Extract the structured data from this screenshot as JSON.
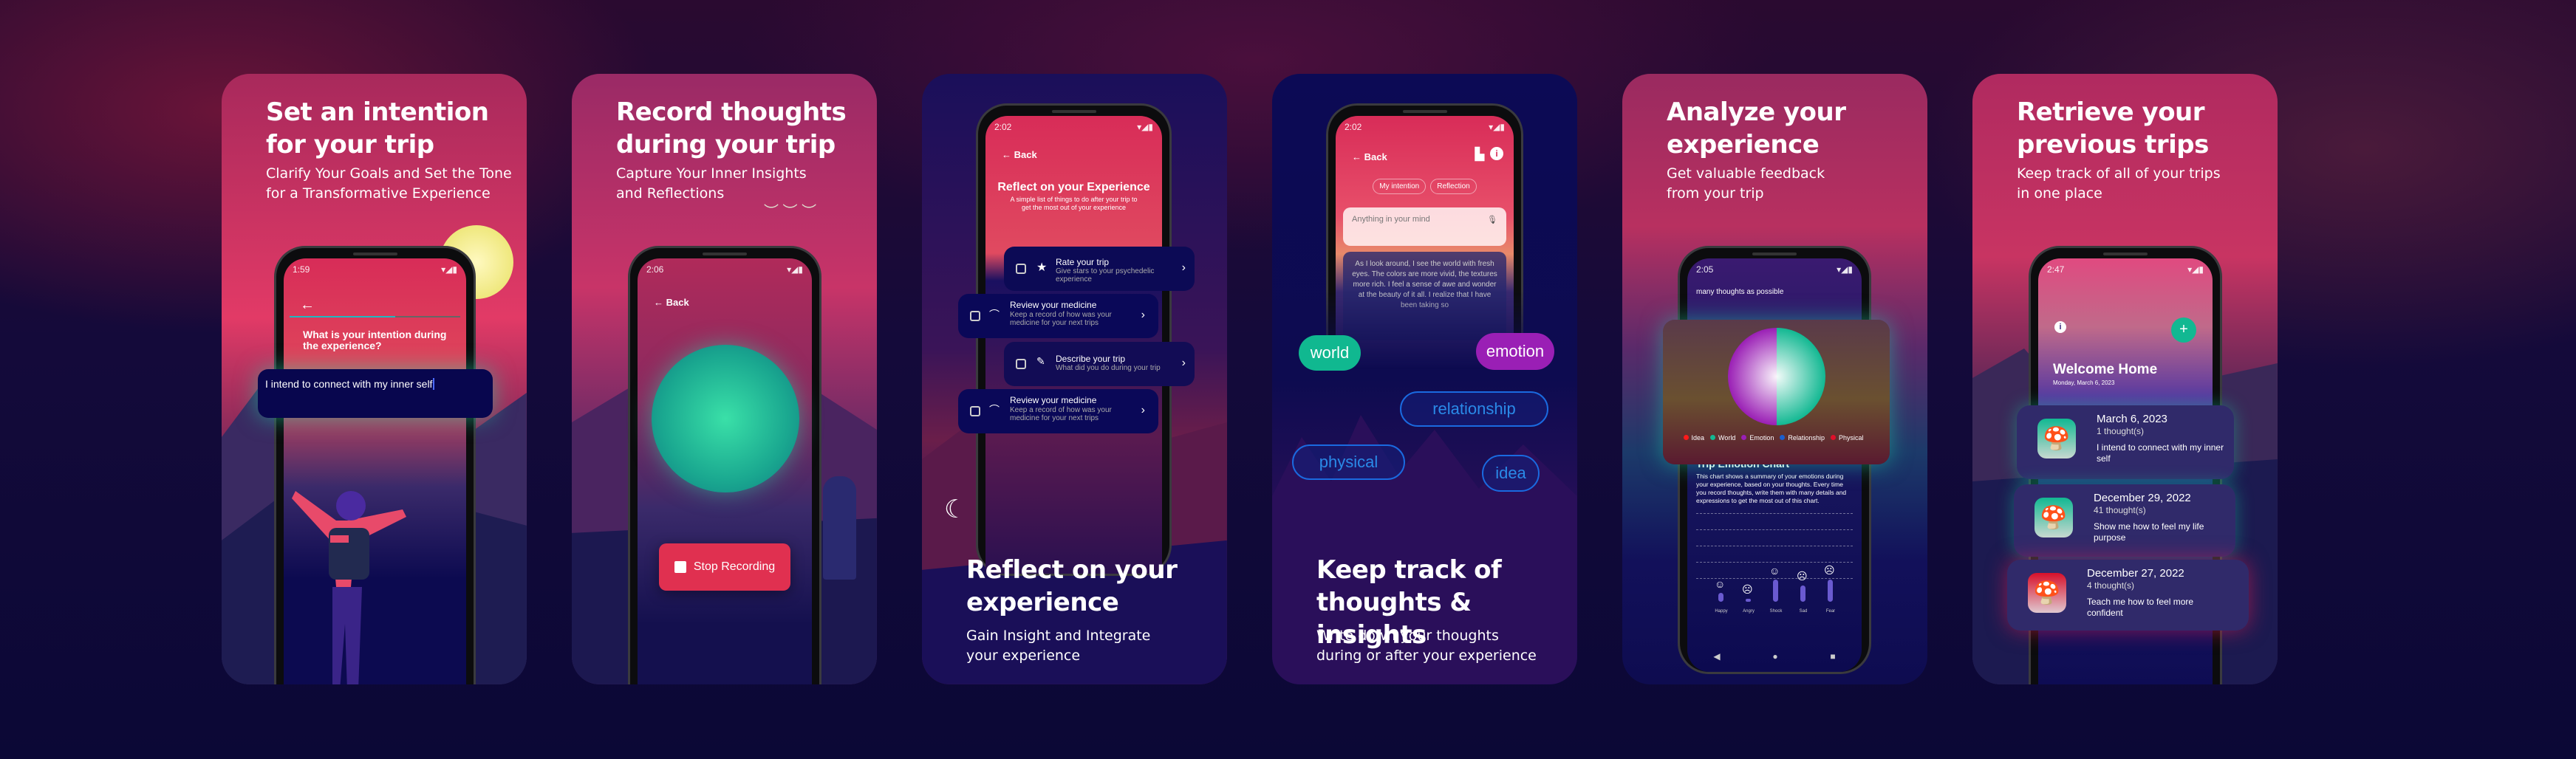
{
  "colors": {
    "accent_green": "#12b892",
    "accent_purple": "#9a1fb5",
    "accent_pink": "#e23a66",
    "navy": "#0a0850",
    "stop_red": "#e03050"
  },
  "panels": [
    {
      "title": [
        "Set an intention",
        "for your trip"
      ],
      "subtitle": [
        "Clarify Your Goals and Set the Tone",
        "for a Transformative Experience"
      ],
      "phone": {
        "time": "1:59",
        "question": "What is your intention during the experience?",
        "input_value": "I intend to connect with my inner self"
      }
    },
    {
      "title": [
        "Record thoughts",
        "during your trip"
      ],
      "subtitle": [
        "Capture Your Inner Insights",
        "and Reflections"
      ],
      "phone": {
        "time": "2:06",
        "back": "Back",
        "stop_button": "Stop Recording"
      }
    },
    {
      "title": [
        "Reflect on your",
        "experience"
      ],
      "subtitle": [
        "Gain Insight and Integrate",
        "your experience"
      ],
      "phone": {
        "time": "2:02",
        "back": "Back",
        "heading": "Reflect on your Experience",
        "description": "A simple list of things to do after your trip to get the most out of your experience",
        "items": [
          {
            "icon": "star-icon",
            "title": "Rate your trip",
            "desc": "Give stars to your psychedelic experience"
          },
          {
            "icon": "rainbow-icon",
            "title": "Review your medicine",
            "desc": "Keep a record of how was your medicine for your next trips"
          },
          {
            "icon": "pencil-icon",
            "title": "Describe your trip",
            "desc": "What did you do during your trip"
          },
          {
            "icon": "rainbow-icon",
            "title": "Review your medicine",
            "desc": "Keep a record of how was your medicine for your next trips"
          }
        ]
      }
    },
    {
      "title": [
        "Keep track of",
        "thoughts & insights"
      ],
      "subtitle": [
        "Write down your thoughts",
        "during or after your experience"
      ],
      "phone": {
        "time": "2:02",
        "back": "Back",
        "tabs": [
          "My intention",
          "Reflection"
        ],
        "input_placeholder": "Anything in your mind",
        "thought_text": "As I look around, I see the world with fresh eyes. The colors are more vivid, the textures more rich. I feel a sense of awe and wonder at the beauty of it all. I realize that I have been taking so"
      },
      "chips": [
        "world",
        "emotion",
        "relationship",
        "physical",
        "idea"
      ]
    },
    {
      "title": [
        "Analyze your",
        "experience"
      ],
      "subtitle": [
        "Get valuable feedback",
        "from your trip"
      ],
      "phone": {
        "time": "2:05",
        "top_text": "many thoughts as possible",
        "chart_title": "Trip Emotion Chart",
        "chart_desc": "This chart shows a summary of your emotions during your experience, based on your thoughts. Every time you record thoughts, write them with many details and expressions to get the most out of this chart.",
        "legend": [
          {
            "label": "Idea",
            "color": "#ff1a1a"
          },
          {
            "label": "World",
            "color": "#12b892"
          },
          {
            "label": "Emotion",
            "color": "#9a1fb5"
          },
          {
            "label": "Relationship",
            "color": "#1a5fd0"
          },
          {
            "label": "Physical",
            "color": "#e0102a"
          }
        ],
        "pie": [
          {
            "label": "Emotion",
            "value": 50,
            "color": "#9a1fb5"
          },
          {
            "label": "World",
            "value": 50,
            "color": "#12b892"
          }
        ],
        "emotions": [
          {
            "label": "Happy",
            "icon": "smile-icon",
            "glyph": "☺",
            "level": 0.1
          },
          {
            "label": "Angry",
            "icon": "angry-icon",
            "glyph": "☹",
            "level": 0
          },
          {
            "label": "Shock",
            "icon": "shock-icon",
            "glyph": "☺",
            "level": 0.33
          },
          {
            "label": "Sad",
            "icon": "sad-icon",
            "glyph": "☹",
            "level": 0.22
          },
          {
            "label": "Fear",
            "icon": "fear-icon",
            "glyph": "☹",
            "level": 0.33
          }
        ]
      }
    },
    {
      "title": [
        "Retrieve your",
        "previous trips"
      ],
      "subtitle": [
        "Keep track of all of your trips",
        "in one place"
      ],
      "phone": {
        "time": "2:47",
        "heading": "Welcome Home",
        "date": "Monday, March 6, 2023",
        "trips": [
          {
            "date": "March 6, 2023",
            "count": "1 thought(s)",
            "note": "I intend to connect with my inner self",
            "color": "green"
          },
          {
            "date": "December 29, 2022",
            "count": "41 thought(s)",
            "note": "Show me how to feel my life purpose",
            "color": "green"
          },
          {
            "date": "December 27, 2022",
            "count": "4 thought(s)",
            "note": "Teach me how to feel more confident",
            "color": "red"
          }
        ]
      }
    }
  ]
}
